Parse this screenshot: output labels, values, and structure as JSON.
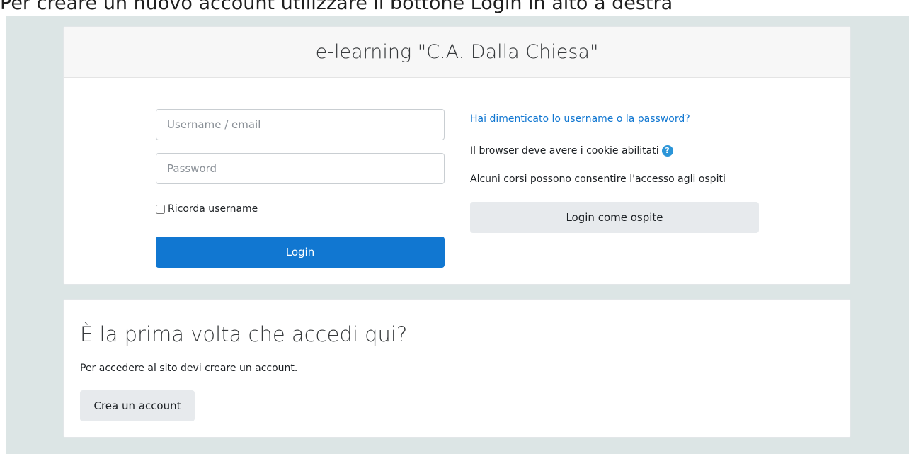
{
  "caption": "Per creare un nuovo account utilizzare il bottone Login in alto a destra",
  "login_card": {
    "site_title": "e-learning \"C.A. Dalla Chiesa\"",
    "username_placeholder": "Username / email",
    "password_placeholder": "Password",
    "remember_label": "Ricorda username",
    "remember_checked": false,
    "login_button": "Login",
    "forgot_link": "Hai dimenticato lo username o la password?",
    "cookie_notice": "Il browser deve avere i cookie abilitati",
    "help_icon": "question-circle-icon",
    "guest_notice": "Alcuni corsi possono consentire l'accesso agli ospiti",
    "guest_button": "Login come ospite"
  },
  "signup_card": {
    "title": "È la prima volta che accedi qui?",
    "description": "Per accedere al sito devi creare un account.",
    "create_button": "Crea un account"
  },
  "colors": {
    "page_background": "#dce5e5",
    "primary": "#1177d1",
    "secondary_button": "#e7eaed",
    "link": "#1177d1"
  }
}
